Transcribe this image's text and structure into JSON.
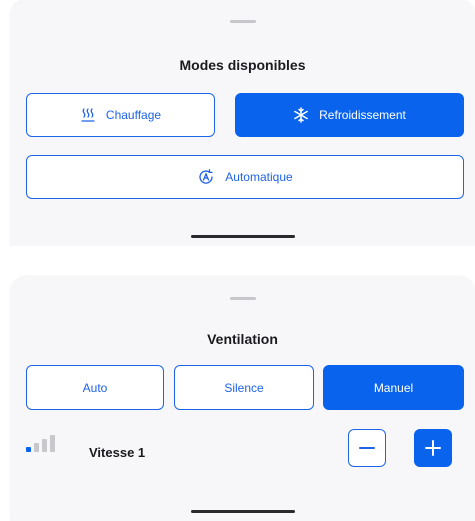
{
  "modes": {
    "title": "Modes disponibles",
    "options": [
      {
        "label": "Chauffage",
        "icon": "heat-waves-icon",
        "selected": false
      },
      {
        "label": "Refroidissement",
        "icon": "snowflake-icon",
        "selected": true
      },
      {
        "label": "Automatique",
        "icon": "auto-mode-icon",
        "selected": false
      }
    ]
  },
  "ventilation": {
    "title": "Ventilation",
    "options": [
      {
        "label": "Auto",
        "selected": false
      },
      {
        "label": "Silence",
        "selected": false
      },
      {
        "label": "Manuel",
        "selected": true
      }
    ],
    "speed": {
      "label": "Vitesse 1",
      "level": 1,
      "max_level": 4
    }
  },
  "colors": {
    "accent": "#0a63ec",
    "inactive_bar": "#c8c8cc",
    "sheet_bg": "#f7f7f9"
  }
}
